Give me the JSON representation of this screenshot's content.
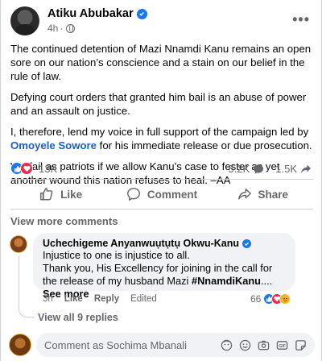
{
  "post": {
    "author": "Atiku Abubakar",
    "time": "4h",
    "time_sep": "·",
    "more": "•••",
    "paragraphs": [
      "The continued detention of Mazi Nnamdi Kanu remains an open sore on our nation’s conscience and a stain on our belief in the rule of law.",
      "Defying court orders that granted him bail is an abuse of power and an assault on justice."
    ],
    "p3_before": "I, therefore, lend my voice in full support of the campaign led by ",
    "p3_mention": "Omoyele Sowore",
    "p3_after": " for his immediate release or due prosecution.",
    "p4": "We fail as patriots if we allow Kanu’s case to fester as yet another wound this nation refuses to heal. –AA"
  },
  "stats": {
    "reactions_count": "13K",
    "comments_count": "5.2K",
    "shares_count": "1.5K"
  },
  "actions": {
    "like": "Like",
    "comment": "Comment",
    "share": "Share"
  },
  "view_more_comments": "View more comments",
  "comment": {
    "author": "Uchechigeme Anyanwuụtụtụ Okwu-Kanu",
    "line1": "Injustice to one is injustice to all.",
    "line2": "Thank you, His Excellency for joining in the call for the release of my husband Mazi ",
    "hashtag": "#NnamdiKanu",
    "ellipsis": ".... ",
    "see_more": "See more",
    "time": "3h",
    "like": "Like",
    "reply": "Reply",
    "edited": "Edited",
    "reactions_count": "66",
    "view_replies": "View all 9 replies"
  },
  "composer": {
    "placeholder": "Comment as Sochima Mbanali"
  },
  "colors": {
    "accent": "#1877f2",
    "love": "#f02849",
    "care": "#f7b125",
    "muted": "#65676b"
  },
  "icons": [
    "globe-icon",
    "more-icon",
    "verified-icon",
    "like-icon",
    "comment-icon",
    "share-icon",
    "emoji-icon",
    "camera-icon",
    "gif-icon",
    "sticker-icon"
  ]
}
